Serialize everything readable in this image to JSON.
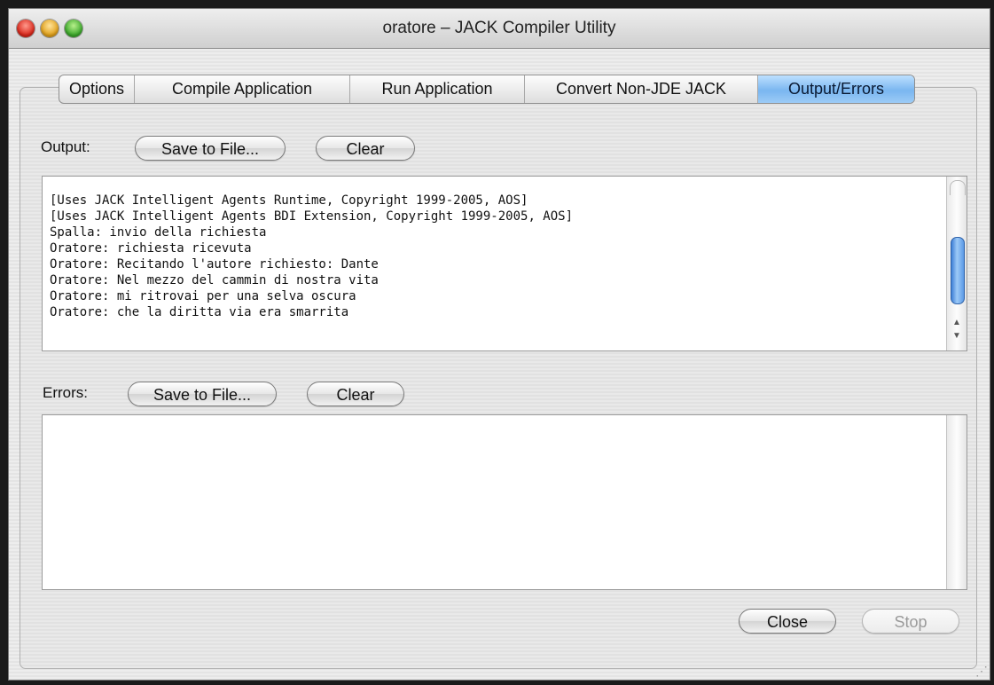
{
  "window": {
    "title": "oratore – JACK Compiler Utility"
  },
  "tabs": [
    {
      "label": "Options",
      "selected": false
    },
    {
      "label": "Compile Application",
      "selected": false
    },
    {
      "label": "Run Application",
      "selected": false
    },
    {
      "label": "Convert Non-JDE JACK",
      "selected": false
    },
    {
      "label": "Output/Errors",
      "selected": true
    }
  ],
  "output": {
    "label": "Output:",
    "save_label": "Save to File...",
    "clear_label": "Clear",
    "lines": [
      "[Uses JACK Intelligent Agents Runtime, Copyright 1999-2005, AOS]",
      "[Uses JACK Intelligent Agents BDI Extension, Copyright 1999-2005, AOS]",
      "Spalla: invio della richiesta",
      "Oratore: richiesta ricevuta",
      "Oratore: Recitando l'autore richiesto: Dante",
      "Oratore: Nel mezzo del cammin di nostra vita",
      "Oratore: mi ritrovai per una selva oscura",
      "Oratore: che la diritta via era smarrita"
    ]
  },
  "errors": {
    "label": "Errors:",
    "save_label": "Save to File...",
    "clear_label": "Clear"
  },
  "footer": {
    "close_label": "Close",
    "stop_label": "Stop"
  },
  "colors": {
    "selected_tab": "#7ab6f0",
    "scroll_thumb": "#3d7fd6"
  }
}
